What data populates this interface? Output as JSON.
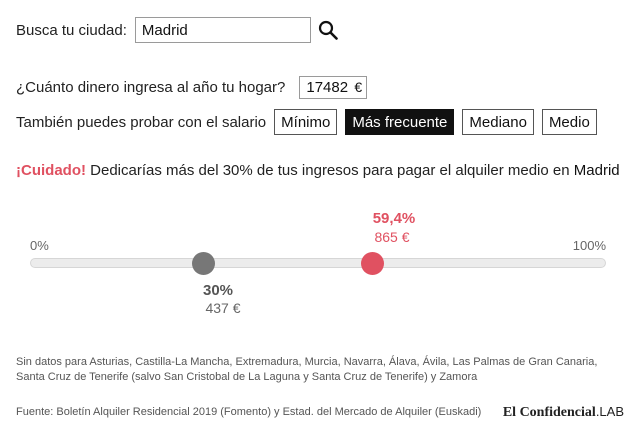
{
  "search": {
    "label": "Busca tu ciudad:",
    "value": "Madrid",
    "icon": "search-icon"
  },
  "income": {
    "label": "¿Cuánto dinero ingresa al año tu hogar?",
    "value": "17482",
    "currency": "€"
  },
  "salary": {
    "label": "También puedes probar con el salario",
    "options": [
      "Mínimo",
      "Más frecuente",
      "Mediano",
      "Medio"
    ],
    "selected": "Más frecuente"
  },
  "warning": {
    "prefix": "¡Cuidado!",
    "text": " Dedicarías más del 30% de tus ingresos para pagar el alquiler medio en ",
    "city": "Madrid"
  },
  "slider": {
    "min_label": "0%",
    "max_label": "100%",
    "threshold": {
      "pct_label": "30%",
      "eur_label": "437 €",
      "value": 30
    },
    "rent": {
      "pct_label": "59,4%",
      "eur_label": "865 €",
      "value": 59.4
    },
    "colors": {
      "rent": "#e05161",
      "threshold": "#777777",
      "track": "#ececec"
    }
  },
  "notes": "Sin datos para Asturias, Castilla-La Mancha, Extremadura, Murcia, Navarra, Álava, Ávila, Las Palmas de Gran Canaria, Santa Cruz de Tenerife (salvo San Cristobal de La Laguna y Santa Cruz de Tenerife) y Zamora",
  "source": "Fuente: Boletín Alquiler Residencial 2019 (Fomento) y Estad. del Mercado de Alquiler (Euskadi)",
  "brand": {
    "name": "El Confidencial",
    "suffix": ".LAB"
  }
}
